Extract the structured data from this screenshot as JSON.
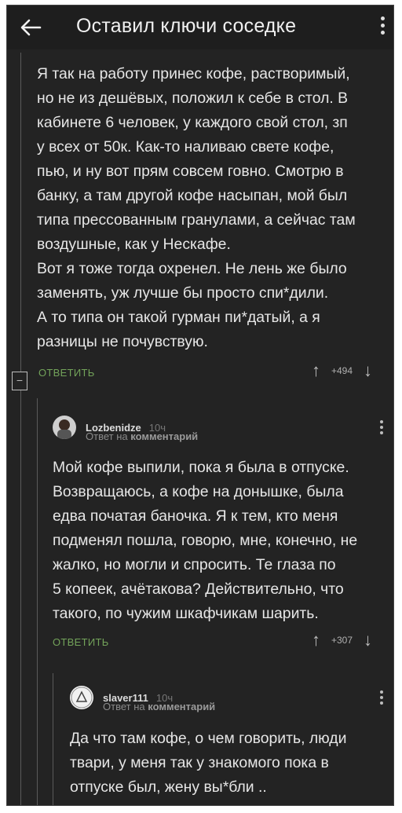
{
  "header": {
    "title": "Оставил ключи соседке"
  },
  "comments": [
    {
      "text": "Я так на работу принес кофе, растворимый,\nно не из дешёвых, положил к себе в стол. В\nкабинете 6 человек, у каждого свой стол, зп\nу всех от 50к. Как-то наливаю свете кофе,\nпью, и ну вот прям совсем говно. Смотрю в\nбанку, а там другой кофе насыпан, мой был\nтипа прессованным гранулами, а сейчас там\nвоздушные, как у Нескафе.\nВот я тоже тогда охренел. Не лень же было\nзаменять, уж лучше бы просто спи*дили.\nА то типа он такой гурман пи*датый, а я\nразницы не почувствую.",
      "reply_label": "ОТВЕТИТЬ",
      "votes": "+494"
    },
    {
      "author": "Lozbenidze",
      "time": "10ч",
      "reply_prefix": "Ответ на",
      "reply_target": "комментарий",
      "text": "Мой кофе выпили, пока я была в отпуске.\nВозвращаюсь, а кофе на донышке, была\nедва початая баночка. Я к тем, кто меня\nподменял пошла, говорю, мне, конечно, не\nжалко, но могли и спросить. Те глаза по\n5 копеек, ачётакова? Действительно, что\nтакого, по чужим шкафчикам шарить.",
      "reply_label": "ОТВЕТИТЬ",
      "votes": "+307"
    },
    {
      "author": "slaver111",
      "time": "10ч",
      "reply_prefix": "Ответ на",
      "reply_target": "комментарий",
      "text": "Да что там кофе, о чем говорить, люди\nтвари, у меня так у знакомого пока в\nотпуске был, жену вы*бли .."
    }
  ],
  "collapse_symbol": "−",
  "colors": {
    "background": "#232323",
    "accent_green": "#73a35a",
    "text": "#e6e6e6"
  }
}
